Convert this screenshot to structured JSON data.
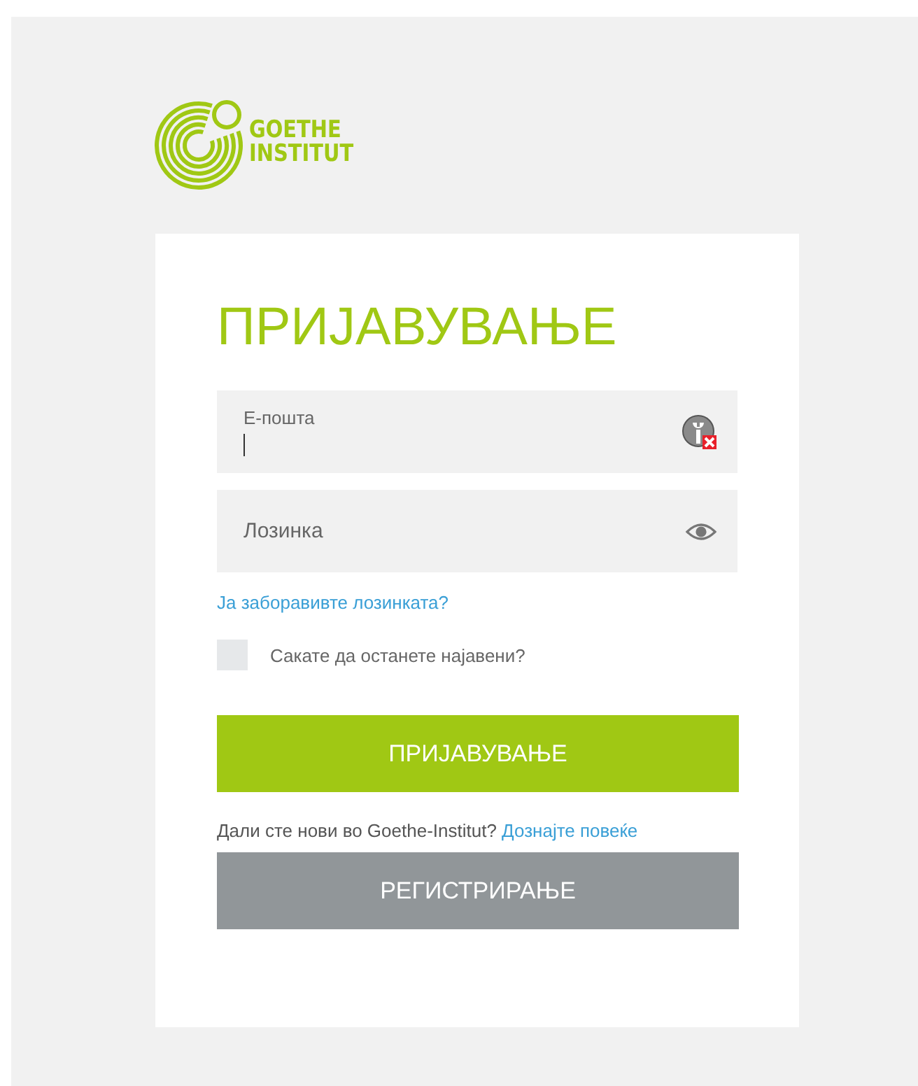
{
  "logo": {
    "text": [
      "GOETHE",
      "INSTITUT"
    ]
  },
  "title": "ПРИЈАВУВАЊЕ",
  "fields": [
    {
      "kind": "email",
      "label": "Е-пошта",
      "focused": true
    },
    {
      "kind": "password",
      "placeholder": "Лозинка",
      "focused": false
    }
  ],
  "forgot_link": "Ја заборавивте лозинката?",
  "remember": {
    "label": "Сакате да останете најавени?",
    "checked": false
  },
  "login_button": "ПРИЈАВУВАЊЕ",
  "register_prompt": {
    "text": "Дали сте нови во Goethe-Institut?",
    "link": "Дознајте повеќе"
  },
  "register_button": "РЕГИСТРИРАЊЕ"
}
